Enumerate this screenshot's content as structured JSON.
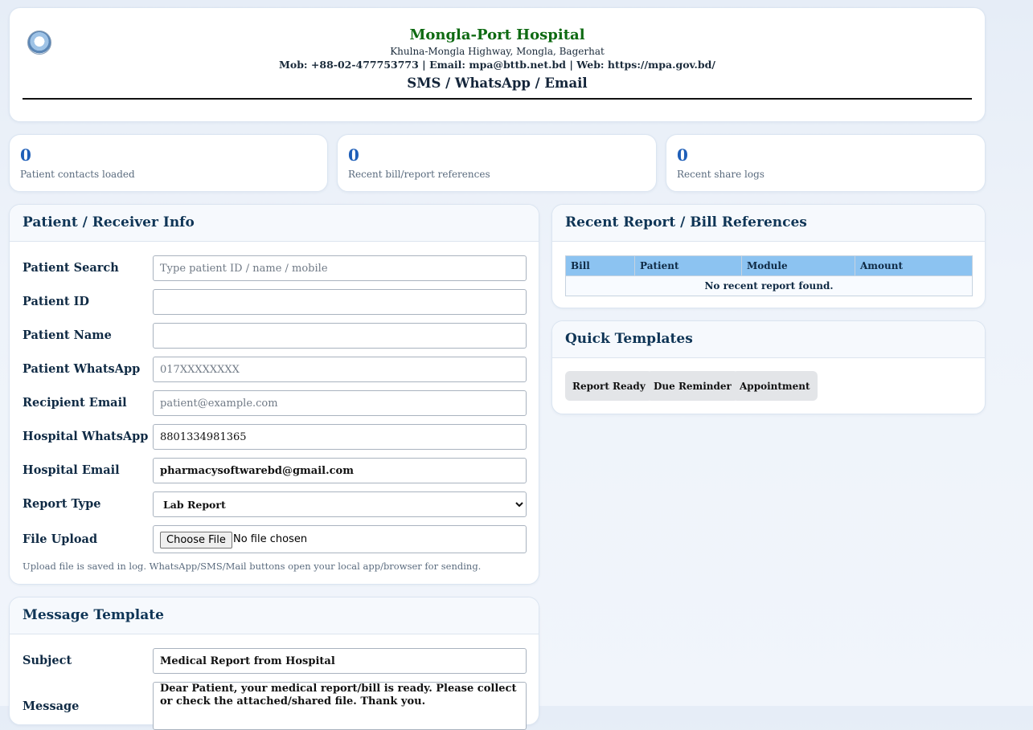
{
  "header": {
    "hospital_name": "Mongla-Port Hospital",
    "address": "Khulna-Mongla Highway, Mongla, Bagerhat",
    "contact": "Mob: +88-02-477753773 | Email: mpa@bttb.net.bd | Web: https://mpa.gov.bd/",
    "subtitle": "SMS / WhatsApp / Email"
  },
  "stats": [
    {
      "value": "0",
      "label": "Patient contacts loaded"
    },
    {
      "value": "0",
      "label": "Recent bill/report references"
    },
    {
      "value": "0",
      "label": "Recent share logs"
    }
  ],
  "patient_panel": {
    "title": "Patient / Receiver Info",
    "search_label": "Patient Search",
    "search_placeholder": "Type patient ID / name / mobile",
    "id_label": "Patient ID",
    "name_label": "Patient Name",
    "whatsapp_label": "Patient WhatsApp",
    "whatsapp_placeholder": "017XXXXXXXX",
    "email_label": "Recipient Email",
    "email_placeholder": "patient@example.com",
    "hosp_whatsapp_label": "Hospital WhatsApp",
    "hosp_whatsapp_value": "8801334981365",
    "hosp_email_label": "Hospital Email",
    "hosp_email_value": "pharmacysoftwarebd@gmail.com",
    "report_type_label": "Report Type",
    "report_type_value": "Lab Report",
    "file_label": "File Upload",
    "file_button": "Choose File",
    "file_status": "No file chosen",
    "note": "Upload file is saved in log. WhatsApp/SMS/Mail buttons open your local app/browser for sending."
  },
  "message_panel": {
    "title": "Message Template",
    "subject_label": "Subject",
    "subject_value": "Medical Report from Hospital",
    "message_label": "Message",
    "message_value": "Dear Patient, your medical report/bill is ready. Please collect or check the attached/shared file. Thank you."
  },
  "refs_panel": {
    "title": "Recent Report / Bill References",
    "columns": [
      "Bill",
      "Patient",
      "Module",
      "Amount"
    ],
    "empty_text": "No recent report found."
  },
  "templates_panel": {
    "title": "Quick Templates",
    "buttons": [
      "Report Ready",
      "Due Reminder",
      "Appointment"
    ]
  }
}
